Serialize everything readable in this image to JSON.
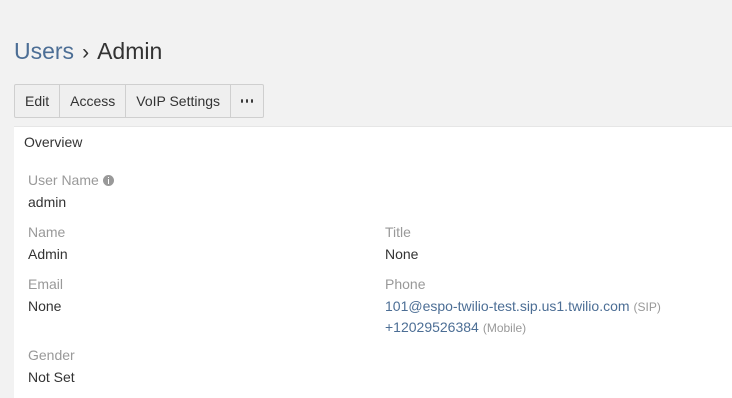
{
  "breadcrumb": {
    "parent": "Users",
    "separator": "›",
    "current": "Admin"
  },
  "toolbar": {
    "buttons": [
      "Edit",
      "Access",
      "VoIP Settings"
    ],
    "more_icon": "ellipsis-icon"
  },
  "panel": {
    "heading": "Overview",
    "fields": {
      "user_name": {
        "label": "User Name",
        "value": "admin",
        "icon": "info-icon"
      },
      "name": {
        "label": "Name",
        "value": "Admin"
      },
      "title": {
        "label": "Title",
        "value": "None"
      },
      "email": {
        "label": "Email",
        "value": "None"
      },
      "phone": {
        "label": "Phone",
        "numbers": [
          {
            "number": "101@espo-twilio-test.sip.us1.twilio.com",
            "type": "(SIP)"
          },
          {
            "number": "+12029526384",
            "type": "(Mobile)"
          }
        ]
      },
      "gender": {
        "label": "Gender",
        "value": "Not Set"
      }
    }
  }
}
